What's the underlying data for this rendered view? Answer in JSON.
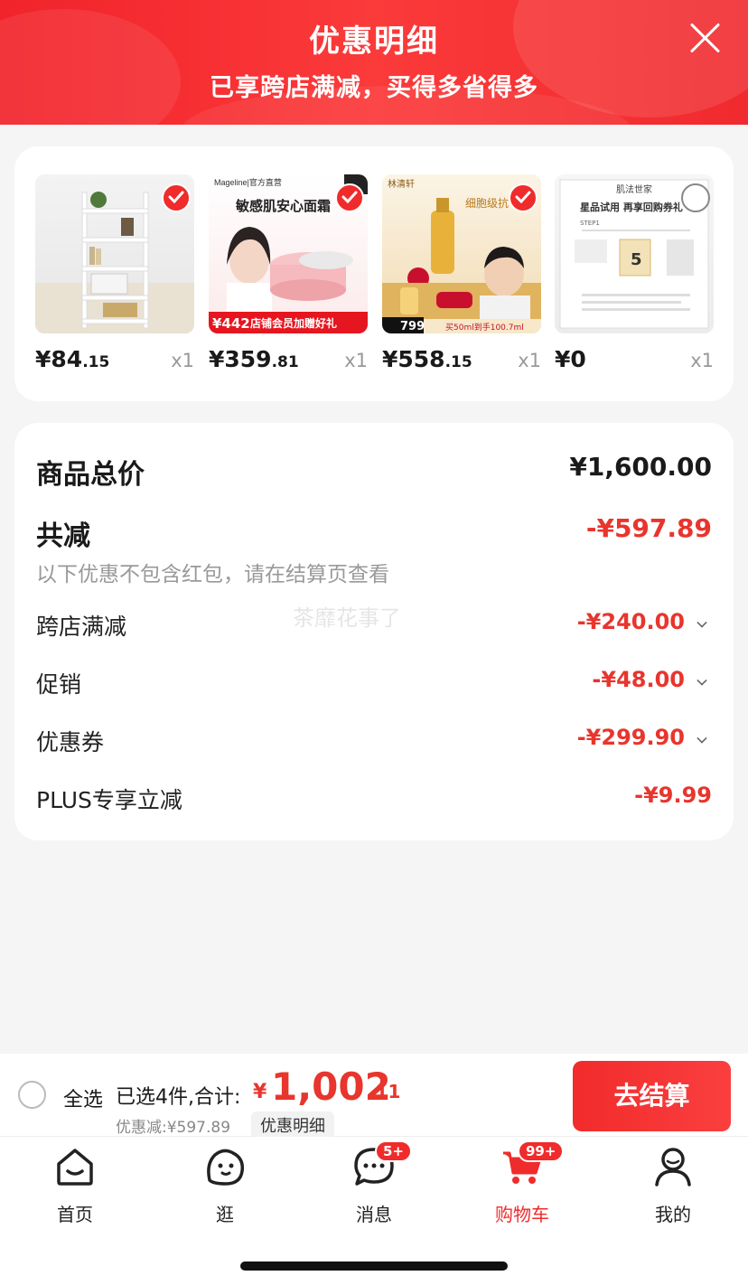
{
  "header": {
    "title": "优惠明细",
    "subtitle": "已享跨店满减，买得多省得多"
  },
  "products": [
    {
      "price_int": "¥84",
      "price_dec": ".15",
      "qty": "x1",
      "checked": true,
      "icon": "bookshelf-image"
    },
    {
      "price_int": "¥359",
      "price_dec": ".81",
      "qty": "x1",
      "checked": true,
      "icon": "face-cream-image",
      "ad_brand": "Mageline|官方直营",
      "ad_title": "敏感肌安心面霜",
      "ad_price": "¥442",
      "ad_banner": "店铺会员加赠好礼"
    },
    {
      "price_int": "¥558",
      "price_dec": ".15",
      "qty": "x1",
      "checked": true,
      "icon": "serum-set-image",
      "ad_brand": "林清轩",
      "ad_title": "细胞级抗",
      "ad_price": "799",
      "ad_banner": "买50ml到手100.7ml"
    },
    {
      "price_int": "¥0",
      "price_dec": "",
      "qty": "x1",
      "checked": false,
      "icon": "trial-pack-image",
      "ad_brand": "肌法世家",
      "ad_title": "星品试用 再享回购券礼",
      "ad_step_label": "STEP1",
      "ad_number": "5"
    }
  ],
  "summary": {
    "total_label": "商品总价",
    "total_value": "¥1,600.00",
    "reduce_label": "共减",
    "reduce_value": "-¥597.89",
    "note": "以下优惠不包含红包，请在结算页查看",
    "watermark": "茶靡花事了",
    "details": [
      {
        "label": "跨店满减",
        "value": "-¥240.00",
        "expandable": true
      },
      {
        "label": "促销",
        "value": "-¥48.00",
        "expandable": true
      },
      {
        "label": "优惠券",
        "value": "-¥299.90",
        "expandable": true
      },
      {
        "label": "PLUS专享立减",
        "value": "-¥9.99",
        "expandable": false
      }
    ]
  },
  "checkout": {
    "select_all": "全选",
    "selected_text": "已选4件,合计:",
    "currency": "¥",
    "total_int": "1,002",
    "total_dec": ".11",
    "discount_text": "优惠减:¥597.89",
    "detail_link": "优惠明细",
    "button": "去结算"
  },
  "tabbar": [
    {
      "label": "首页",
      "icon": "home-icon"
    },
    {
      "label": "逛",
      "icon": "browse-icon"
    },
    {
      "label": "消息",
      "icon": "message-icon",
      "badge": "5+"
    },
    {
      "label": "购物车",
      "icon": "cart-icon",
      "badge": "99+",
      "active": true
    },
    {
      "label": "我的",
      "icon": "profile-icon"
    }
  ],
  "colors": {
    "accent": "#f02b2b",
    "discount": "#e8352d"
  }
}
